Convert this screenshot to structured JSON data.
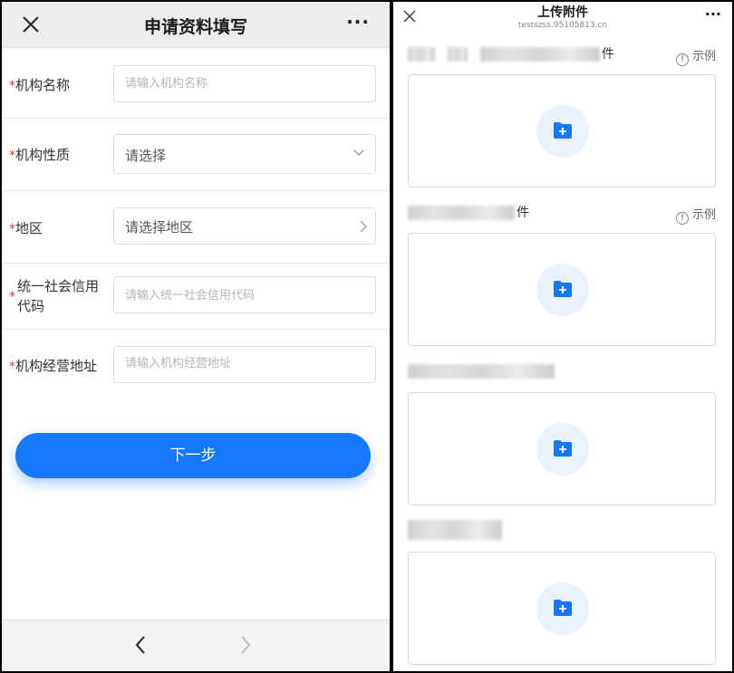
{
  "left": {
    "header": {
      "title": "申请资料填写",
      "more": "···"
    },
    "form": [
      {
        "label": "机构名称",
        "required": "*",
        "type": "input",
        "placeholder": "请输入机构名称"
      },
      {
        "label": "机构性质",
        "required": "*",
        "type": "select",
        "value": "请选择"
      },
      {
        "label": "地区",
        "required": "*",
        "type": "picker",
        "value": "请选择地区"
      },
      {
        "label": "统一社会信用代码",
        "required": "*",
        "type": "input",
        "placeholder": "请输入统一社会信用代码"
      },
      {
        "label": "机构经营地址",
        "required": "*",
        "type": "input",
        "placeholder": "请输入机构经营地址"
      }
    ],
    "next_button": "下一步"
  },
  "right": {
    "header": {
      "title": "上传附件",
      "url": "testszss.95105813.cn",
      "more": "···"
    },
    "sections": [
      {
        "label_visible": "件",
        "example": "示例"
      },
      {
        "label_visible": "件",
        "example": "示例"
      },
      {
        "label_visible": ""
      },
      {
        "label_visible": ""
      }
    ]
  },
  "colors": {
    "primary": "#1677ff",
    "required": "#e53935",
    "icon_bg": "#e9f2fd"
  }
}
